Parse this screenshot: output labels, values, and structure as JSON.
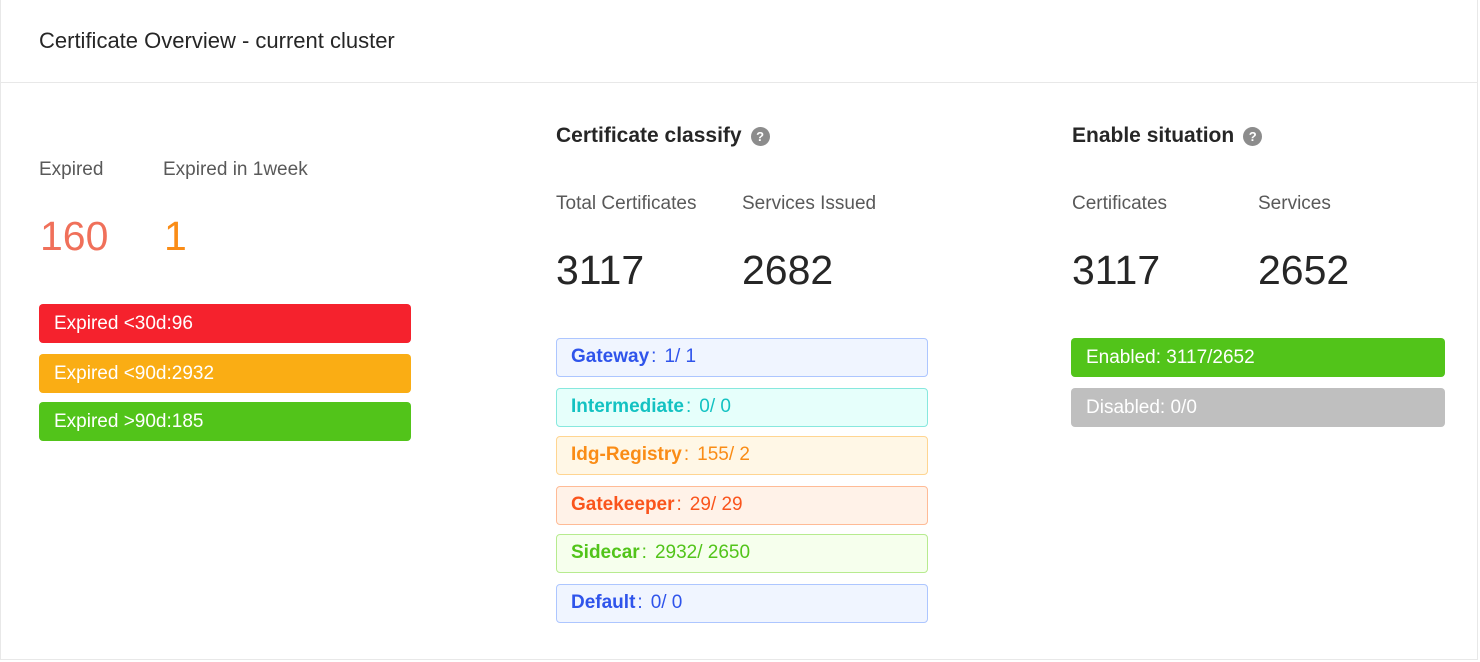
{
  "card": {
    "title": "Certificate Overview - current cluster"
  },
  "expiry": {
    "expired_label": "Expired",
    "expired_value": "160",
    "week_label": "Expired in 1week",
    "week_value": "1",
    "bars": [
      {
        "text": "Expired <30d:96",
        "color": "#f5222d"
      },
      {
        "text": "Expired <90d:2932",
        "color": "#faad14"
      },
      {
        "text": "Expired >90d:185",
        "color": "#52c41a"
      }
    ],
    "colors": {
      "expired": "#f0705a",
      "week": "#fa8c16"
    }
  },
  "classify": {
    "title": "Certificate classify",
    "help_icon": "question-circle-icon",
    "total_label": "Total Certificates",
    "total_value": "3117",
    "issued_label": "Services Issued",
    "issued_value": "2682",
    "tags": [
      {
        "name": "Gateway",
        "sep": ":",
        "value": "1/ 1",
        "color": "#2f54eb",
        "bg": "#f0f5ff",
        "border": "#adc6ff"
      },
      {
        "name": "Intermediate",
        "sep": ":",
        "value": "0/ 0",
        "color": "#13c2c2",
        "bg": "#e6fffb",
        "border": "#87e8de"
      },
      {
        "name": "Idg-Registry",
        "sep": ":",
        "value": "155/ 2",
        "color": "#fa8c16",
        "bg": "#fff7e6",
        "border": "#ffd591"
      },
      {
        "name": "Gatekeeper",
        "sep": ":",
        "value": "29/ 29",
        "color": "#fa541c",
        "bg": "#fff2e8",
        "border": "#ffbb96"
      },
      {
        "name": "Sidecar",
        "sep": ":",
        "value": "2932/ 2650",
        "color": "#52c41a",
        "bg": "#f6ffed",
        "border": "#b7eb8f"
      },
      {
        "name": "Default",
        "sep": ":",
        "value": "0/ 0",
        "color": "#2f54eb",
        "bg": "#f0f5ff",
        "border": "#adc6ff"
      }
    ]
  },
  "enable": {
    "title": "Enable situation",
    "help_icon": "question-circle-icon",
    "cert_label": "Certificates",
    "cert_value": "3117",
    "services_label": "Services",
    "services_value": "2652",
    "bars": [
      {
        "text": "Enabled: 3117/2652",
        "color": "#52c41a"
      },
      {
        "text": "Disabled: 0/0",
        "color": "#bfbfbf"
      }
    ]
  }
}
